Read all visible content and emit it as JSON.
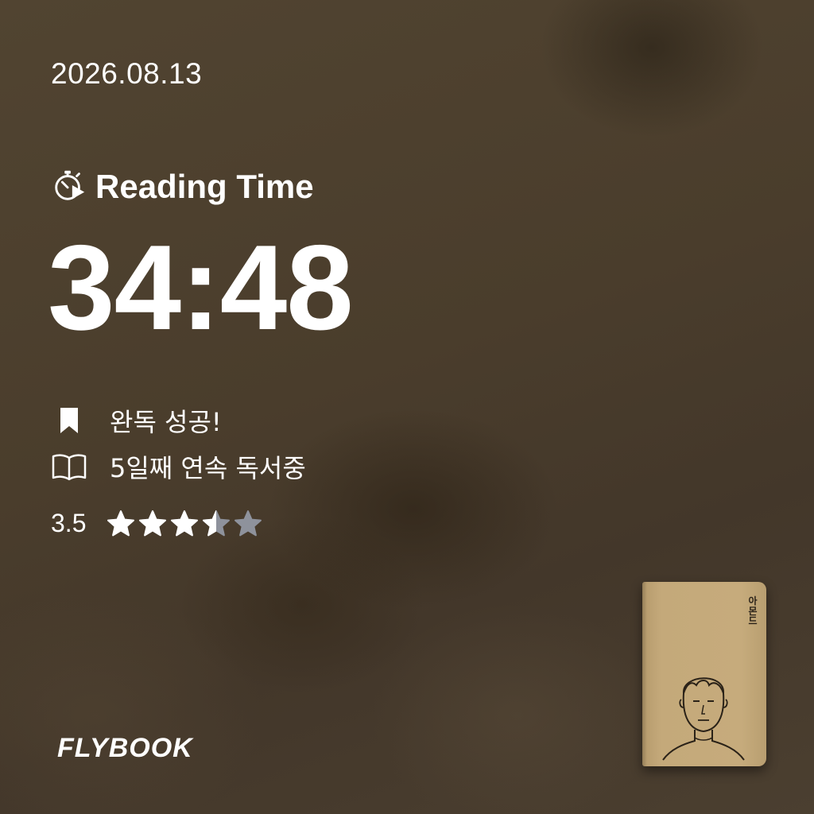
{
  "date": "2026.08.13",
  "reading": {
    "label": "Reading Time",
    "icon": "stopwatch-play-icon",
    "time": "34:48"
  },
  "status": [
    {
      "icon": "bookmark-icon",
      "text": "완독 성공!"
    },
    {
      "icon": "open-book-icon",
      "text": "5일째 연속 독서중"
    }
  ],
  "rating": {
    "value": "3.5",
    "score": 3.5,
    "max": 5,
    "filled_color": "#ffffff",
    "empty_color": "#8e929c"
  },
  "brand": {
    "logo": "FLYBOOK"
  },
  "book": {
    "cover_title": "아몬드"
  },
  "colors": {
    "background": "#4a3d2c",
    "text": "#ffffff",
    "book_cover": "#c4a97a"
  }
}
